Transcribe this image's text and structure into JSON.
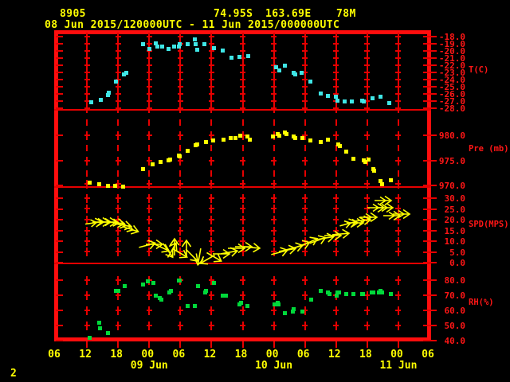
{
  "header": {
    "station_id": "8905",
    "latitude": "74.95S",
    "longitude": "163.69E",
    "elevation": "78M",
    "time_range": "08 Jun 2015/120000UTC - 11 Jun 2015/000000UTC"
  },
  "footer": {
    "page_number": "2"
  },
  "colors": {
    "background": "#000000",
    "frame_red": "#ff0d0d",
    "grid_red": "#e60000",
    "label_red": "#ff1616",
    "text_yellow": "#ffff00",
    "temperature": "#3fe6e6",
    "pressure": "#ffff00",
    "wind": "#ffff00",
    "humidity": "#00d93a"
  },
  "x_axis": {
    "t_start": 6,
    "t_end": 78,
    "tick_interval_hours": 6,
    "hour_labels": [
      "06",
      "12",
      "18",
      "00",
      "06",
      "12",
      "18",
      "00",
      "06",
      "12",
      "18",
      "00",
      "06"
    ],
    "date_labels": [
      {
        "text": "09 Jun",
        "t": 24
      },
      {
        "text": "10 Jun",
        "t": 48
      },
      {
        "text": "11 Jun",
        "t": 72
      }
    ]
  },
  "chart_data": [
    {
      "type": "scatter",
      "name": "temperature",
      "label": "T(C)",
      "color": "#3fe6e6",
      "ylim": [
        -28.2,
        -17.6
      ],
      "ytick_values": [
        -18,
        -19,
        -20,
        -21,
        -22,
        -23,
        -24,
        -25,
        -26,
        -27,
        -28
      ],
      "ytick_labels": [
        "-18.0",
        "-19.0",
        "-20.0",
        "-21.0",
        "-22.0",
        "-23.0",
        "-24.0",
        "-25.0",
        "-26.0",
        "-27.0",
        "-28.0"
      ],
      "points": [
        [
          12.9,
          -27.2
        ],
        [
          14.6,
          -26.8
        ],
        [
          16.0,
          -26.2
        ],
        [
          16.2,
          -25.8
        ],
        [
          17.6,
          -24.3
        ],
        [
          19.2,
          -23.3
        ],
        [
          19.6,
          -23.0
        ],
        [
          22.8,
          -19.0
        ],
        [
          24.1,
          -19.7
        ],
        [
          25.3,
          -18.9
        ],
        [
          25.6,
          -19.4
        ],
        [
          26.5,
          -19.4
        ],
        [
          27.7,
          -19.7
        ],
        [
          28.8,
          -19.4
        ],
        [
          29.7,
          -19.4
        ],
        [
          29.9,
          -19.0
        ],
        [
          31.4,
          -19.1
        ],
        [
          32.8,
          -18.4
        ],
        [
          33.0,
          -19.0
        ],
        [
          33.3,
          -19.8
        ],
        [
          34.6,
          -19.0
        ],
        [
          36.5,
          -19.6
        ],
        [
          38.2,
          -19.9
        ],
        [
          39.8,
          -20.9
        ],
        [
          41.4,
          -20.8
        ],
        [
          43.1,
          -20.7
        ],
        [
          48.4,
          -22.3
        ],
        [
          49.0,
          -22.7
        ],
        [
          50.1,
          -22.0
        ],
        [
          51.8,
          -23.0
        ],
        [
          52.1,
          -23.3
        ],
        [
          53.3,
          -23.1
        ],
        [
          55.0,
          -24.3
        ],
        [
          57.0,
          -25.9
        ],
        [
          58.4,
          -26.3
        ],
        [
          59.9,
          -26.4
        ],
        [
          60.2,
          -26.9
        ],
        [
          61.6,
          -27.1
        ],
        [
          63.1,
          -27.0
        ],
        [
          65.0,
          -26.9
        ],
        [
          65.3,
          -27.0
        ],
        [
          67.0,
          -26.6
        ],
        [
          68.6,
          -26.4
        ],
        [
          70.3,
          -27.3
        ]
      ]
    },
    {
      "type": "scatter",
      "name": "pressure",
      "label": "Pre (mb)",
      "color": "#ffff00",
      "ylim": [
        969.7,
        984.9
      ],
      "ytick_values": [
        980,
        975,
        970
      ],
      "ytick_labels": [
        "980.0",
        "975.0",
        "970.0"
      ],
      "points": [
        [
          12.6,
          970.6
        ],
        [
          14.4,
          970.2
        ],
        [
          16.0,
          969.9
        ],
        [
          17.5,
          970.0
        ],
        [
          19.0,
          969.8
        ],
        [
          22.8,
          973.3
        ],
        [
          24.7,
          974.2
        ],
        [
          26.2,
          974.7
        ],
        [
          27.7,
          975.0
        ],
        [
          28.1,
          975.2
        ],
        [
          29.7,
          975.9
        ],
        [
          29.9,
          975.8
        ],
        [
          31.4,
          976.9
        ],
        [
          33.0,
          978.0
        ],
        [
          33.3,
          978.1
        ],
        [
          34.9,
          978.6
        ],
        [
          36.3,
          978.9
        ],
        [
          38.3,
          979.1
        ],
        [
          39.7,
          979.4
        ],
        [
          40.6,
          979.5
        ],
        [
          41.5,
          979.9
        ],
        [
          42.9,
          979.7
        ],
        [
          43.4,
          979.2
        ],
        [
          47.8,
          979.8
        ],
        [
          48.7,
          980.3
        ],
        [
          49.0,
          980.0
        ],
        [
          50.1,
          980.5
        ],
        [
          50.4,
          980.3
        ],
        [
          51.8,
          979.8
        ],
        [
          52.1,
          979.5
        ],
        [
          53.5,
          979.4
        ],
        [
          55.0,
          978.9
        ],
        [
          57.0,
          978.6
        ],
        [
          58.5,
          979.1
        ],
        [
          60.4,
          978.1
        ],
        [
          60.7,
          977.8
        ],
        [
          62.0,
          976.7
        ],
        [
          63.4,
          975.3
        ],
        [
          65.3,
          975.0
        ],
        [
          65.6,
          974.7
        ],
        [
          66.2,
          975.2
        ],
        [
          67.1,
          973.3
        ],
        [
          67.3,
          973.0
        ],
        [
          68.6,
          970.8
        ],
        [
          68.9,
          970.2
        ],
        [
          70.5,
          971.1
        ]
      ]
    },
    {
      "type": "scatter",
      "name": "wind-speed",
      "label": "SPD(MPS)",
      "color": "#ffff00",
      "marker": "vector-arrow",
      "ylim": [
        -0.4,
        34.8
      ],
      "ytick_values": [
        30,
        25,
        20,
        15,
        10,
        5,
        0
      ],
      "ytick_labels": [
        "30.0",
        "25.0",
        "20.0",
        "15.0",
        "10.0",
        "5.0",
        "0.0"
      ],
      "points_format": [
        "hour",
        "speed_mps",
        "arrow_dir_deg"
      ],
      "points": [
        [
          13.3,
          18.5,
          -8
        ],
        [
          14.8,
          19.0,
          0
        ],
        [
          16.2,
          19.0,
          0
        ],
        [
          17.6,
          18.5,
          5
        ],
        [
          19.0,
          17.5,
          10
        ],
        [
          20.4,
          15.5,
          18
        ],
        [
          23.6,
          8.0,
          -15
        ],
        [
          25.0,
          8.5,
          0
        ],
        [
          26.4,
          7.0,
          25
        ],
        [
          27.6,
          5.5,
          55
        ],
        [
          28.4,
          6.0,
          -60
        ],
        [
          28.9,
          7.5,
          -90
        ],
        [
          29.9,
          4.5,
          30
        ],
        [
          31.1,
          6.5,
          -90
        ],
        [
          32.3,
          3.5,
          45
        ],
        [
          33.7,
          2.5,
          100
        ],
        [
          35.1,
          1.5,
          150
        ],
        [
          36.5,
          2.5,
          30
        ],
        [
          38.0,
          4.0,
          0
        ],
        [
          39.4,
          5.0,
          -10
        ],
        [
          40.8,
          6.5,
          0
        ],
        [
          42.3,
          7.5,
          0
        ],
        [
          43.7,
          7.0,
          5
        ],
        [
          49.2,
          5.0,
          -15
        ],
        [
          50.6,
          6.0,
          -10
        ],
        [
          52.0,
          7.0,
          -15
        ],
        [
          53.4,
          8.0,
          -20
        ],
        [
          54.9,
          9.5,
          -25
        ],
        [
          56.5,
          10.5,
          -20
        ],
        [
          58.1,
          11.5,
          -10
        ],
        [
          59.5,
          12.5,
          0
        ],
        [
          60.9,
          13.5,
          -5
        ],
        [
          62.3,
          18.0,
          -15
        ],
        [
          63.7,
          18.5,
          0
        ],
        [
          65.1,
          19.5,
          -5
        ],
        [
          66.3,
          21.0,
          0
        ],
        [
          67.7,
          25.5,
          0
        ],
        [
          69.1,
          29.0,
          0
        ],
        [
          69.4,
          25.5,
          0
        ],
        [
          70.8,
          22.0,
          0
        ],
        [
          72.6,
          22.5,
          0
        ]
      ]
    },
    {
      "type": "scatter",
      "name": "relative-humidity",
      "label": "RH(%)",
      "color": "#00d93a",
      "ylim": [
        40.5,
        90.5
      ],
      "ytick_values": [
        80,
        70,
        60,
        50,
        40
      ],
      "ytick_labels": [
        "80.0",
        "70.0",
        "60.0",
        "50.0",
        "40.0"
      ],
      "points": [
        [
          12.6,
          42
        ],
        [
          14.3,
          52
        ],
        [
          14.5,
          48
        ],
        [
          16.0,
          45
        ],
        [
          17.6,
          73
        ],
        [
          18.1,
          73
        ],
        [
          19.3,
          76
        ],
        [
          22.8,
          77
        ],
        [
          23.8,
          79
        ],
        [
          24.8,
          78
        ],
        [
          25.3,
          70
        ],
        [
          26.1,
          68
        ],
        [
          26.4,
          67
        ],
        [
          27.9,
          72
        ],
        [
          28.2,
          73
        ],
        [
          29.7,
          80
        ],
        [
          29.9,
          80
        ],
        [
          31.4,
          63
        ],
        [
          32.8,
          63
        ],
        [
          33.4,
          76
        ],
        [
          34.8,
          72
        ],
        [
          34.9,
          73
        ],
        [
          36.5,
          78
        ],
        [
          38.2,
          70
        ],
        [
          38.8,
          70
        ],
        [
          41.4,
          64
        ],
        [
          41.7,
          65
        ],
        [
          42.9,
          63
        ],
        [
          48.1,
          64
        ],
        [
          48.7,
          65
        ],
        [
          48.9,
          64
        ],
        [
          50.1,
          58
        ],
        [
          51.6,
          59
        ],
        [
          51.8,
          61
        ],
        [
          53.5,
          59
        ],
        [
          55.2,
          67
        ],
        [
          57.0,
          73
        ],
        [
          58.5,
          72
        ],
        [
          58.7,
          71
        ],
        [
          60.1,
          70
        ],
        [
          60.3,
          72
        ],
        [
          60.6,
          72
        ],
        [
          61.9,
          71
        ],
        [
          63.4,
          71
        ],
        [
          65.0,
          71
        ],
        [
          65.2,
          71
        ],
        [
          66.8,
          72
        ],
        [
          67.1,
          72
        ],
        [
          68.3,
          72
        ],
        [
          68.6,
          73
        ],
        [
          68.9,
          72
        ],
        [
          70.5,
          71
        ]
      ]
    }
  ]
}
